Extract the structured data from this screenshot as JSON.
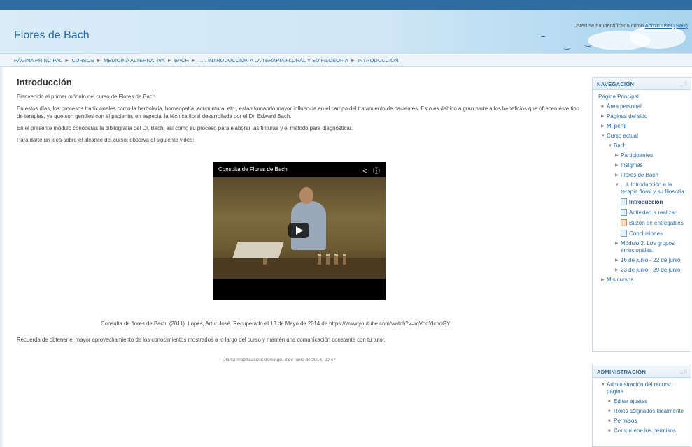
{
  "header": {
    "site_title": "Flores de Bach",
    "login_prefix": "Usted se ha identificado como",
    "user_name": "Admin User",
    "logout_label": "(Salir)"
  },
  "breadcrumb": [
    "PÁGINA PRINCIPAL",
    "CURSOS",
    "MEDICINA ALTERNATIVA",
    "BACH",
    "…I. INTRODUCCIÓN A LA TERAPIA FLORAL Y SU FILOSOFÍA",
    "INTRODUCCIÓN"
  ],
  "main": {
    "title": "Introducción",
    "p1": "Bienvenido al primer módulo del curso de Flores de Bach.",
    "p2": "En estos días, los procesos tradicionales como la herbolaria, homeopatía, acupuntura, etc., están tomando mayor influencia en el campo del tratamiento de pacientes. Esto es debido a gran parte a los beneficios que ofrecen éste tipo de terapias, ya que son gentiles con el paciente, en especial la técnica floral desarrollada por el Dr. Edward Bach.",
    "p3": "En el presente módulo conocerás la bibliografía del Dr. Bach, así como su proceso para elaborar las tinturas y el método para diagnosticar.",
    "p4": "Para darte un idea sobre el alcance del curso, observa el siguiente video:",
    "video_title": "Consulta de Flores de Bach",
    "caption": "Consulta de flores de Bach. (2011). Lopes, Artur José. Recuperado el 18 de Mayo de 2014 de https://www.youtube.com/watch?v=mVndYlchdGY",
    "closing": "Recuerda de obtener el mayor aprovechamiento de los conocimientos mostrados a lo largo del curso y mantén una comunicación constante con tu tutor.",
    "modified": "Última modificación: domingo, 8 de junio de 2014, 20:47"
  },
  "navigation": {
    "title": "NAVEGACIÓN",
    "items": [
      "Página Principal",
      "Área personal",
      "Páginas del sitio",
      "Mi perfil",
      "Curso actual",
      "Bach",
      "Participantes",
      "Insignias",
      "Flores de Bach",
      "…I. Introducción a la terapia floral y su filosofía",
      "Introducción",
      "Actividad a realizar",
      "Buzón de entregables",
      "Conclusiones",
      "Módulo 2: Los grupos emocionales.",
      "16 de junio - 22 de junio",
      "23 de junio - 29 de junio",
      "Mis cursos"
    ]
  },
  "administration": {
    "title": "ADMINISTRACIÓN",
    "items": [
      "Administración del recurso página",
      "Editar ajustes",
      "Roles asignados localmente",
      "Permisos",
      "Compruebe los permisos"
    ]
  }
}
